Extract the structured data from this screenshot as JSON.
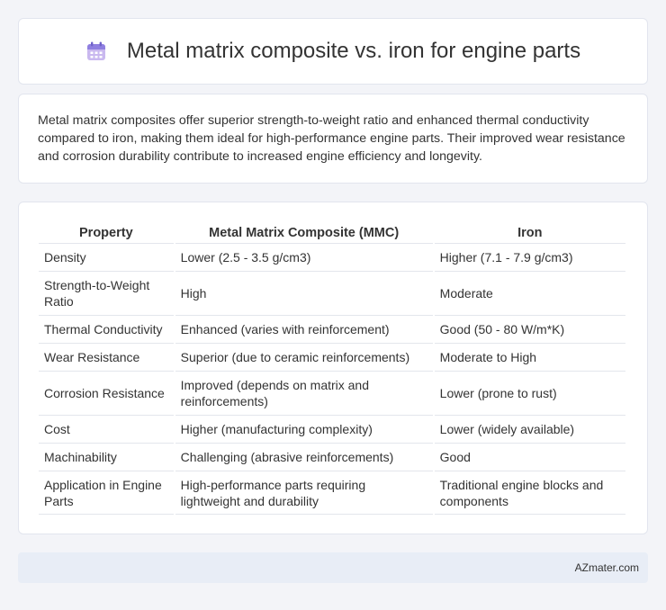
{
  "header": {
    "title": "Metal matrix composite vs. iron for engine parts",
    "icon": "calendar-icon"
  },
  "summary": {
    "text": "Metal matrix composites offer superior strength-to-weight ratio and enhanced thermal conductivity compared to iron, making them ideal for high-performance engine parts. Their improved wear resistance and corrosion durability contribute to increased engine efficiency and longevity."
  },
  "table": {
    "headers": [
      "Property",
      "Metal Matrix Composite (MMC)",
      "Iron"
    ],
    "rows": [
      [
        "Density",
        "Lower (2.5 - 3.5 g/cm3)",
        "Higher (7.1 - 7.9 g/cm3)"
      ],
      [
        "Strength-to-Weight Ratio",
        "High",
        "Moderate"
      ],
      [
        "Thermal Conductivity",
        "Enhanced (varies with reinforcement)",
        "Good (50 - 80 W/m*K)"
      ],
      [
        "Wear Resistance",
        "Superior (due to ceramic reinforcements)",
        "Moderate to High"
      ],
      [
        "Corrosion Resistance",
        "Improved (depends on matrix and reinforcements)",
        "Lower (prone to rust)"
      ],
      [
        "Cost",
        "Higher (manufacturing complexity)",
        "Lower (widely available)"
      ],
      [
        "Machinability",
        "Challenging (abrasive reinforcements)",
        "Good"
      ],
      [
        "Application in Engine Parts",
        "High-performance parts requiring lightweight and durability",
        "Traditional engine blocks and components"
      ]
    ]
  },
  "footer": {
    "brand": "AZmater.com"
  }
}
